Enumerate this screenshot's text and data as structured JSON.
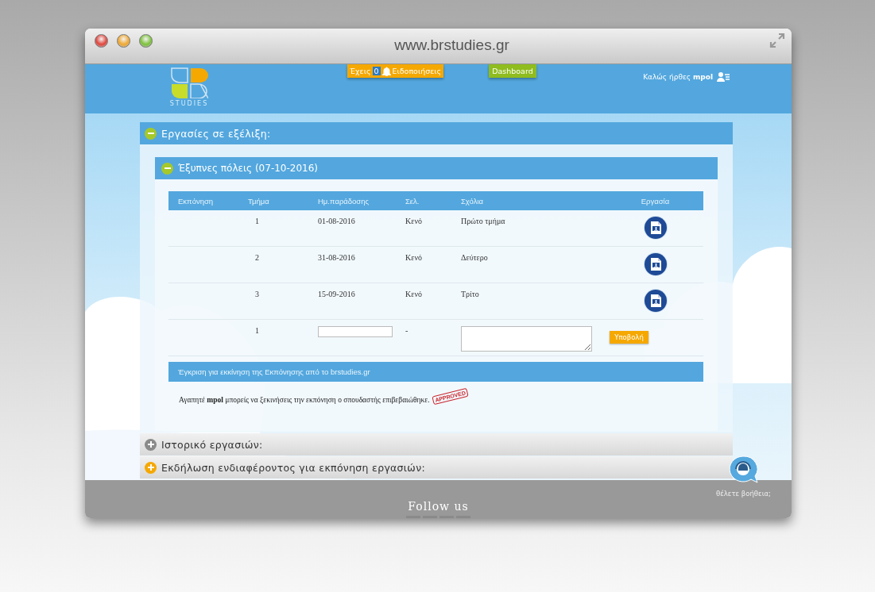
{
  "window": {
    "title": "www.brstudies.gr"
  },
  "header": {
    "logo_text": "STUDIES",
    "notifications": {
      "prefix": "Έχεις",
      "count": "0",
      "label": "Ειδοποιήσεις"
    },
    "dashboard": "Dashboard",
    "welcome": {
      "greeting": "Καλώς ήρθες",
      "user": "mpol"
    }
  },
  "sections": [
    {
      "title": "Εργασίες σε εξέλιξη:",
      "expanded": true,
      "color": "#a5c82a",
      "projects": [
        {
          "title": "Έξυπνες πόλεις (07-10-2016)",
          "expanded": true,
          "table": {
            "columns": [
              "Εκπόνηση",
              "Τμήμα",
              "Ημ.παράδοσης",
              "Σελ.",
              "Σχόλια",
              "Εργασία"
            ],
            "rows": [
              {
                "kind": "delivered",
                "part": "1",
                "date": "01-08-2016",
                "pages": "Κενό",
                "comments": "Πρώτο τμήμα"
              },
              {
                "kind": "delivered",
                "part": "2",
                "date": "31-08-2016",
                "pages": "Κενό",
                "comments": "Δεύτερο"
              },
              {
                "kind": "delivered",
                "part": "3",
                "date": "15-09-2016",
                "pages": "Κενό",
                "comments": "Τρίτο"
              },
              {
                "kind": "upload",
                "part": "1",
                "pages": "-",
                "button": "Υποβολή"
              }
            ]
          },
          "approval": {
            "title": "Έγκριση για εκκίνηση της Εκπόνησης από το brstudies.gr",
            "message": "Αγαπητέ **mpol** μπορείς να ξεκινήσεις την εκπόνηση ο σπουδαστής επιβεβαιώθηκε.",
            "stamp": "APPROVED"
          }
        }
      ]
    },
    {
      "title": "Ιστορικό εργασιών:",
      "expanded": false,
      "color": "#8a8a8a"
    },
    {
      "title": "Εκδήλωση ενδιαφέροντος για εκπόνηση εργασιών:",
      "expanded": false,
      "color": "#f5a800"
    }
  ],
  "footer": {
    "heading": "Follow us",
    "help": "θέλετε βοήθεια;"
  }
}
